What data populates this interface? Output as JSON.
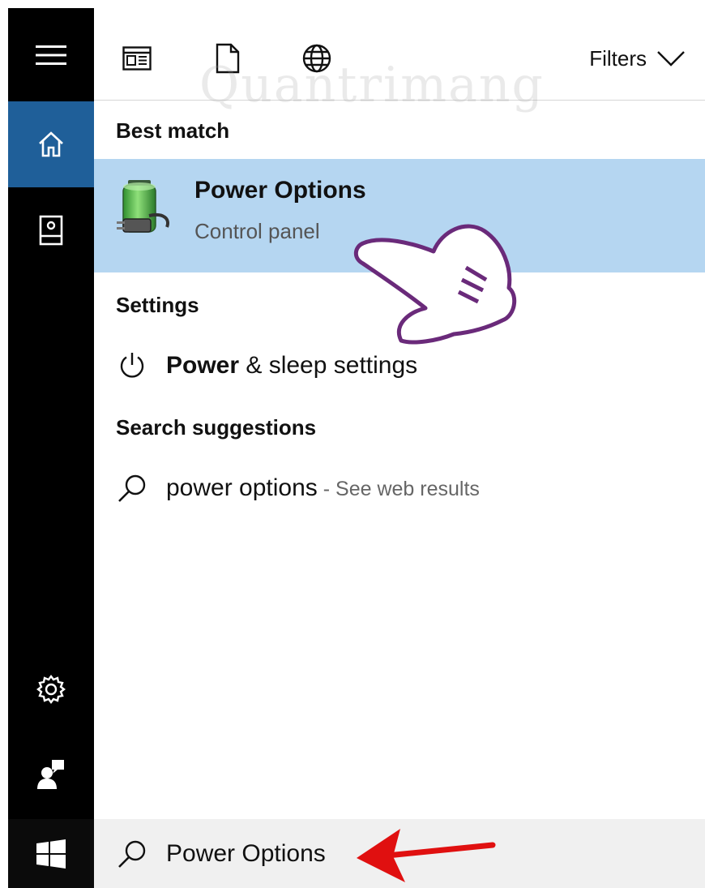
{
  "topbar": {
    "icons": [
      "apps-icon",
      "document-icon",
      "globe-icon"
    ],
    "filters_label": "Filters"
  },
  "watermark": "Quantrimang",
  "best_match": {
    "heading": "Best match",
    "title": "Power Options",
    "subtitle": "Control panel",
    "highlight_color": "#b5d6f1"
  },
  "settings": {
    "heading": "Settings",
    "item_bold": "Power",
    "item_rest": " & sleep settings"
  },
  "suggestions": {
    "heading": "Search suggestions",
    "query": "power options",
    "separator": " - ",
    "hint": "See web results"
  },
  "search": {
    "value": "Power Options"
  },
  "colors": {
    "rail": "#000000",
    "rail_active": "#1f5f99",
    "annotation_arrow": "#e01010",
    "annotation_hand": "#6a2a7a"
  }
}
